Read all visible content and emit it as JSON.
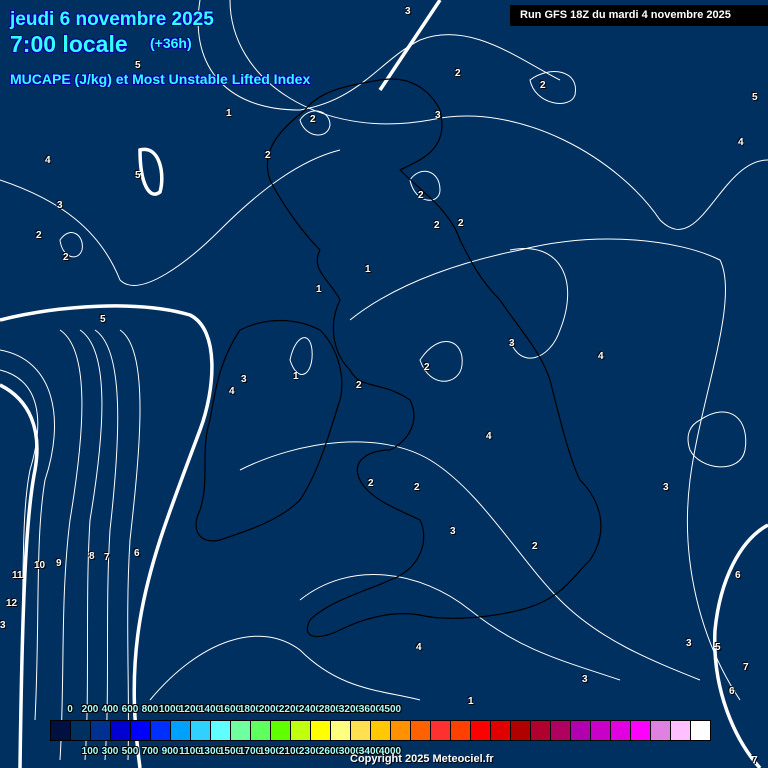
{
  "header": {
    "date": "jeudi 6 novembre 2025",
    "time": "7:00 locale",
    "lead": "(+36h)",
    "parameter": "MUCAPE (J/kg) et Most Unstable Lifted Index",
    "run": "Run GFS 18Z du mardi 4 novembre 2025"
  },
  "legend": {
    "colors": [
      "#001040",
      "#003060",
      "#003090",
      "#0000d0",
      "#0000ff",
      "#0030ff",
      "#00a0ff",
      "#30d0ff",
      "#60ffff",
      "#70ffa0",
      "#60ff60",
      "#60ff00",
      "#c0ff10",
      "#ffff00",
      "#ffff80",
      "#ffe050",
      "#ffc800",
      "#ff9000",
      "#ff6000",
      "#ff3030",
      "#ff4000",
      "#ff0000",
      "#e00000",
      "#b00000",
      "#b00030",
      "#b00060",
      "#b000b0",
      "#c800c8",
      "#e000e0",
      "#ff00ff",
      "#e080e0",
      "#ffc0ff",
      "#ffffff"
    ],
    "top_labels": [
      "0",
      "200",
      "400",
      "600",
      "800",
      "1000",
      "1200",
      "1400",
      "1600",
      "1800",
      "2000",
      "2200",
      "2400",
      "2800",
      "3200",
      "3600",
      "4500"
    ],
    "bottom_labels": [
      "100",
      "300",
      "500",
      "700",
      "900",
      "1100",
      "1300",
      "1500",
      "1700",
      "1900",
      "2100",
      "2300",
      "2600",
      "3000",
      "3400",
      "4000"
    ]
  },
  "contour_labels": [
    "3",
    "5",
    "2",
    "2",
    "5",
    "1",
    "2",
    "3",
    "2",
    "4",
    "5",
    "2",
    "4",
    "3",
    "2",
    "2",
    "2",
    "2",
    "5",
    "1",
    "1",
    "1",
    "4",
    "3",
    "2",
    "2",
    "3",
    "4",
    "4",
    "2",
    "2",
    "3",
    "2",
    "11",
    "10",
    "9",
    "8",
    "7",
    "6",
    "12",
    "3",
    "4",
    "3",
    "6",
    "3",
    "5",
    "7",
    "6",
    "1",
    "3",
    "7"
  ],
  "copyright": "Copyright 2025 Meteociel.fr"
}
